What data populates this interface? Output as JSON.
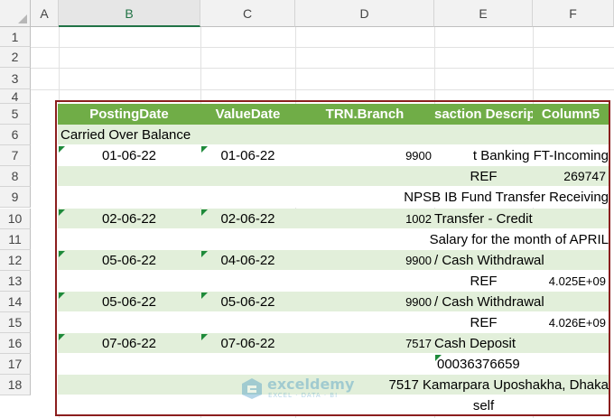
{
  "columns": [
    "A",
    "B",
    "C",
    "D",
    "E",
    "F"
  ],
  "rows": [
    "1",
    "2",
    "3",
    "4",
    "5",
    "6",
    "7",
    "8",
    "9",
    "10",
    "11",
    "12",
    "13",
    "14",
    "15",
    "16",
    "17",
    "18"
  ],
  "header": [
    "PostingDate",
    "ValueDate",
    "TRN.Branch",
    "saction Descrip",
    "Column5"
  ],
  "body": [
    [
      "Carried Over Balance",
      "",
      "",
      "",
      ""
    ],
    [
      "01-06-22",
      "01-06-22",
      "9900",
      "t Banking FT-Incoming",
      ""
    ],
    [
      "",
      "",
      "",
      "REF",
      "269747"
    ],
    [
      "",
      "",
      "",
      "NPSB IB Fund Transfer Receiving",
      ""
    ],
    [
      "02-06-22",
      "02-06-22",
      "1002",
      "Transfer - Credit",
      ""
    ],
    [
      "",
      "",
      "",
      "Salary for the month of APRIL",
      ""
    ],
    [
      "05-06-22",
      "04-06-22",
      "9900",
      "/ Cash Withdrawal",
      ""
    ],
    [
      "",
      "",
      "",
      "REF",
      "4.025E+09"
    ],
    [
      "05-06-22",
      "05-06-22",
      "9900",
      "/ Cash Withdrawal",
      ""
    ],
    [
      "",
      "",
      "",
      "REF",
      "4.026E+09"
    ],
    [
      "07-06-22",
      "07-06-22",
      "7517",
      "Cash Deposit",
      ""
    ],
    [
      "",
      "",
      "",
      "00036376659",
      ""
    ],
    [
      "",
      "",
      "",
      "7517 Kamarpara Uposhakha, Dhaka",
      ""
    ],
    [
      "",
      "",
      "",
      "self",
      ""
    ]
  ],
  "watermark": {
    "name": "exceldemy",
    "tagline": "EXCEL · DATA · BI"
  },
  "colors": {
    "header_fill": "#70ad47",
    "band_fill": "#e2efda",
    "table_border": "#8b1e1e",
    "selected_col": "#217346"
  }
}
